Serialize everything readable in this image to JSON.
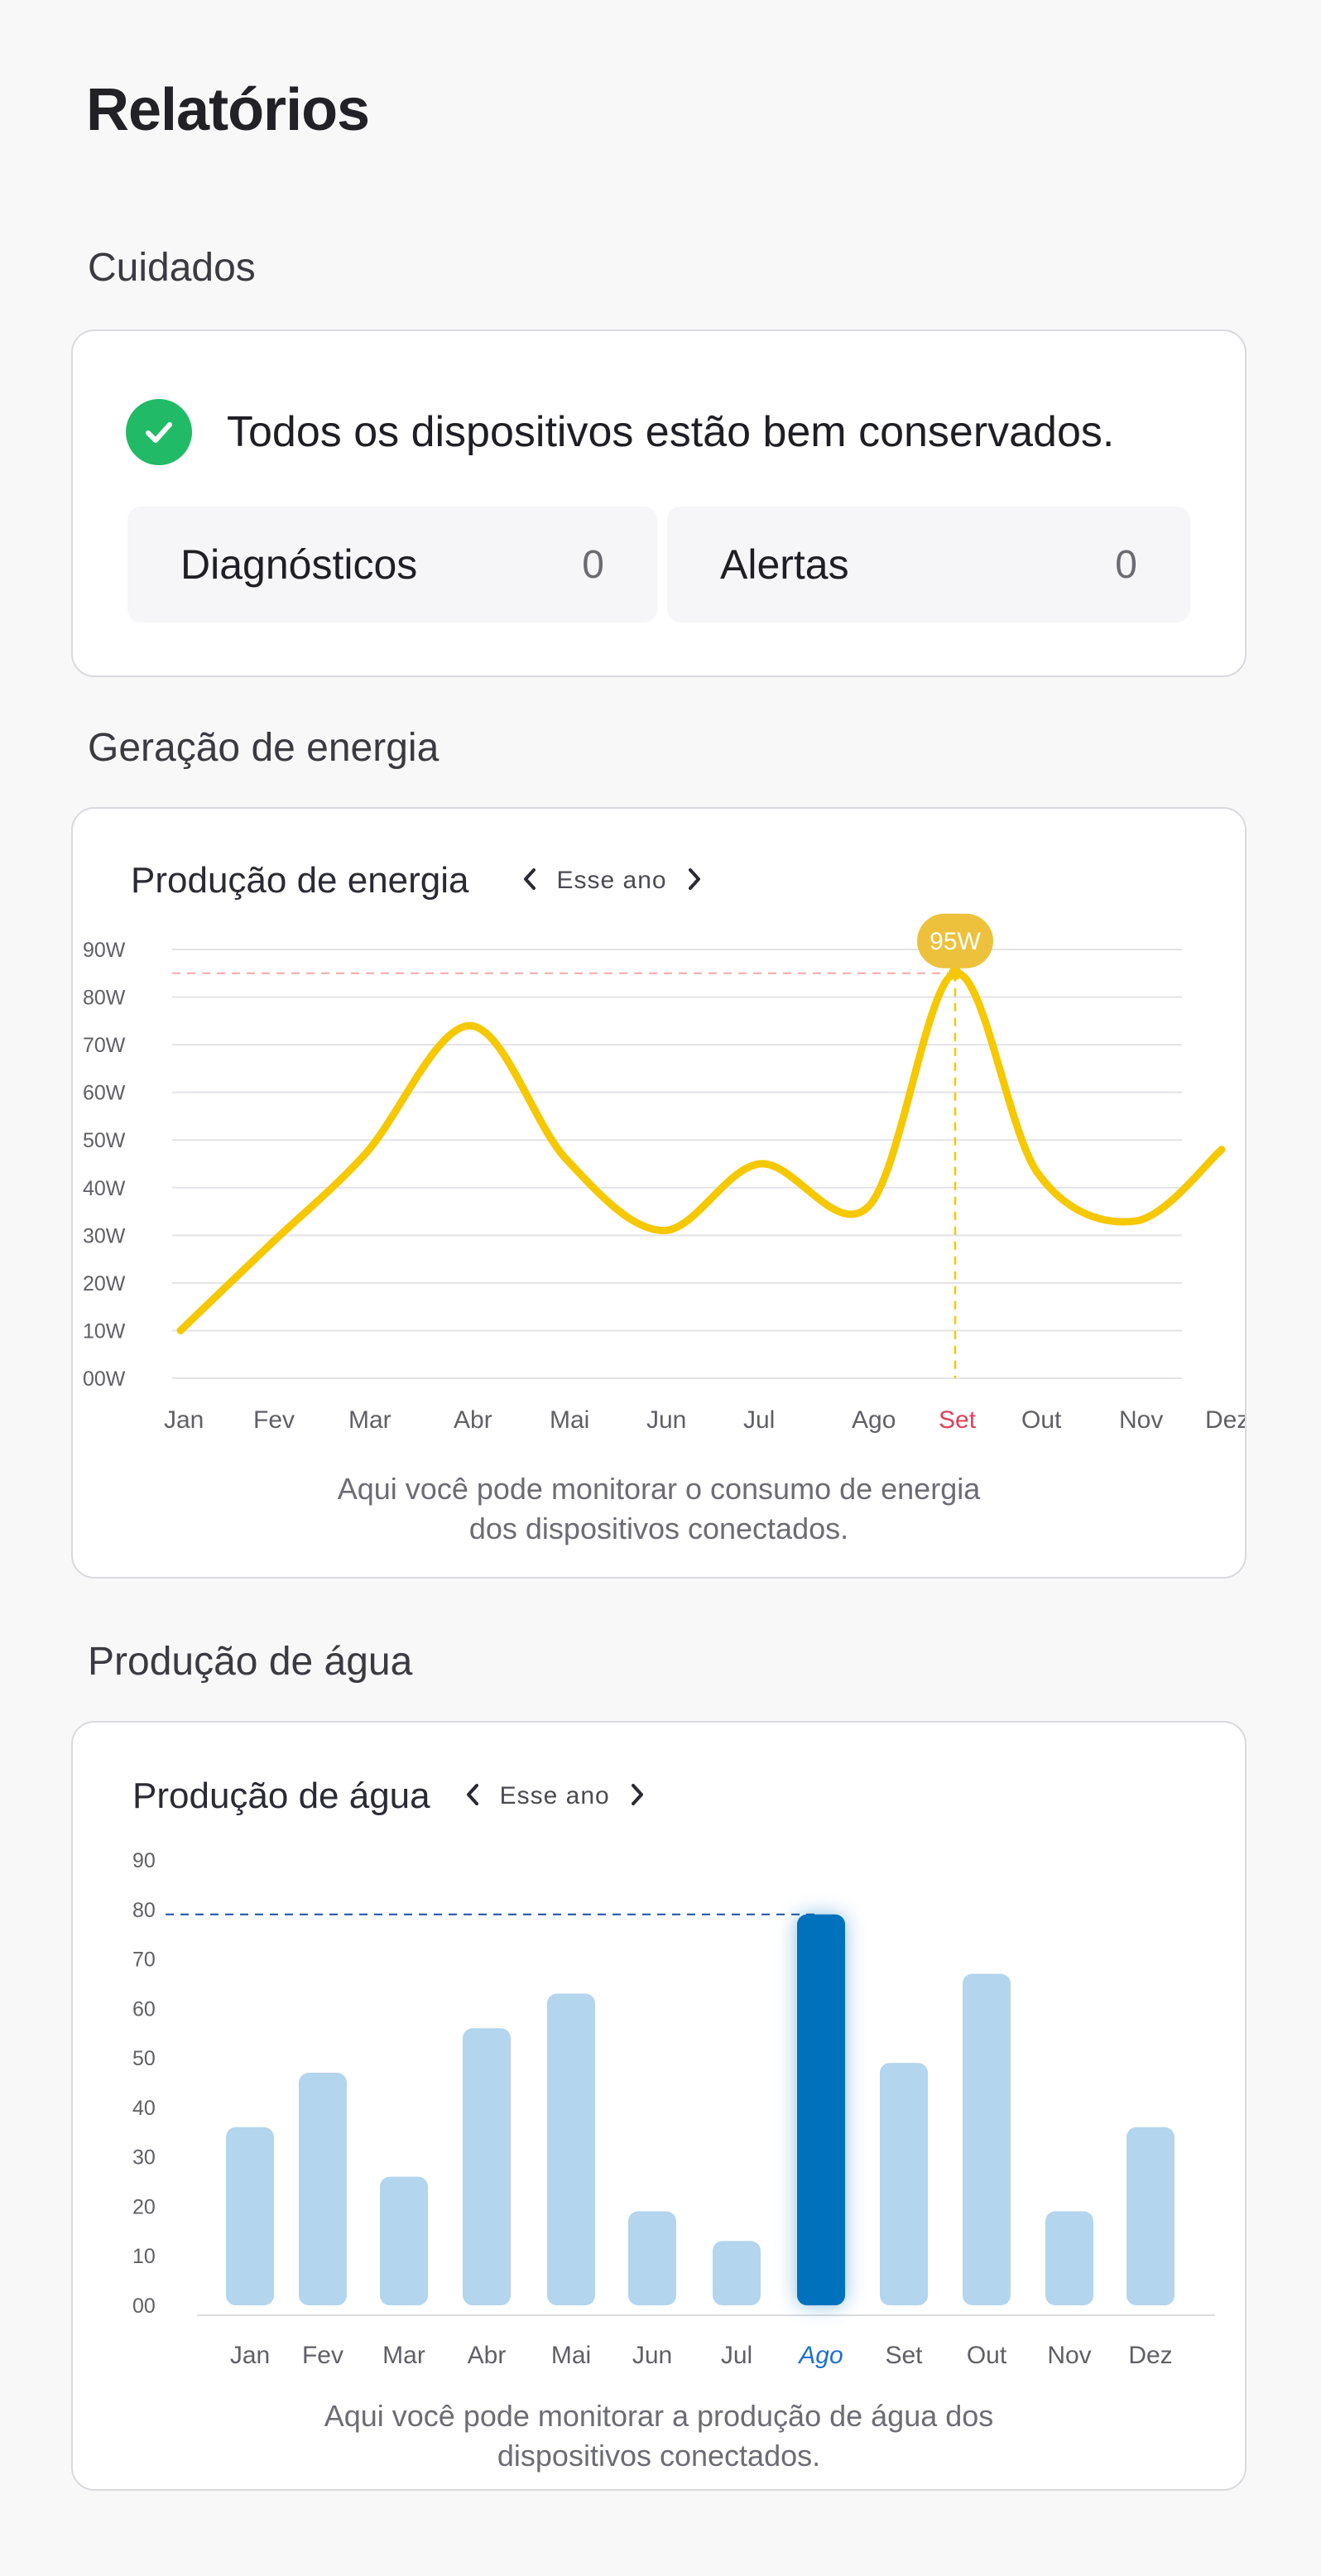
{
  "page": {
    "title": "Relatórios"
  },
  "care": {
    "section_title": "Cuidados",
    "status_text": "Todos os dispositivos estão bem conservados.",
    "status_icon": "check-circle-icon",
    "status_color": "#21ba67",
    "stats": [
      {
        "label": "Diagnósticos",
        "value": "0"
      },
      {
        "label": "Alertas",
        "value": "0"
      }
    ]
  },
  "energy": {
    "section_title": "Geração de energia",
    "chart_title": "Produção de energia",
    "period": "Esse ano",
    "prev_icon": "chevron-left-icon",
    "next_icon": "chevron-right-icon",
    "tooltip": "95W",
    "caption_line1": "Aqui você pode monitorar o consumo de energia",
    "caption_line2": "dos dispositivos conectados.",
    "line_color": "#f5c800",
    "highlight_color": "#e0405a"
  },
  "water": {
    "section_title": "Produção de água",
    "chart_title": "Produção de água",
    "period": "Esse ano",
    "prev_icon": "chevron-left-icon",
    "next_icon": "chevron-right-icon",
    "caption_line1": "Aqui você pode monitorar a produção de água dos",
    "caption_line2": "dispositivos conectados.",
    "bar_color": "#b3d5ee",
    "highlight_bar_color": "#0071bd",
    "highlight_label_color": "#1d6fd0"
  },
  "chart_data": [
    {
      "type": "line",
      "title": "Produção de energia",
      "categories": [
        "Jan",
        "Fev",
        "Mar",
        "Abr",
        "Mai",
        "Jun",
        "Jul",
        "Ago",
        "Set",
        "Out",
        "Nov",
        "Dez"
      ],
      "y_ticks": [
        "00W",
        "10W",
        "20W",
        "30W",
        "40W",
        "50W",
        "60W",
        "70W",
        "80W",
        "90W"
      ],
      "ylim": [
        0,
        90
      ],
      "series": [
        {
          "values": [
            10,
            28,
            47,
            74,
            46,
            31,
            45,
            36,
            85,
            43,
            33,
            48
          ]
        }
      ],
      "highlight": {
        "category": "Set",
        "value": 85,
        "label": "95W"
      },
      "grid": true
    },
    {
      "type": "bar",
      "title": "Produção de água",
      "categories": [
        "Jan",
        "Fev",
        "Mar",
        "Abr",
        "Mai",
        "Jun",
        "Jul",
        "Ago",
        "Set",
        "Out",
        "Nov",
        "Dez"
      ],
      "y_ticks": [
        "00",
        "10",
        "20",
        "30",
        "40",
        "50",
        "60",
        "70",
        "80",
        "90"
      ],
      "ylim": [
        0,
        90
      ],
      "values": [
        36,
        47,
        26,
        56,
        63,
        19,
        13,
        79,
        49,
        67,
        19,
        36
      ],
      "highlight": {
        "category": "Ago",
        "value": 79
      },
      "grid": false
    }
  ]
}
